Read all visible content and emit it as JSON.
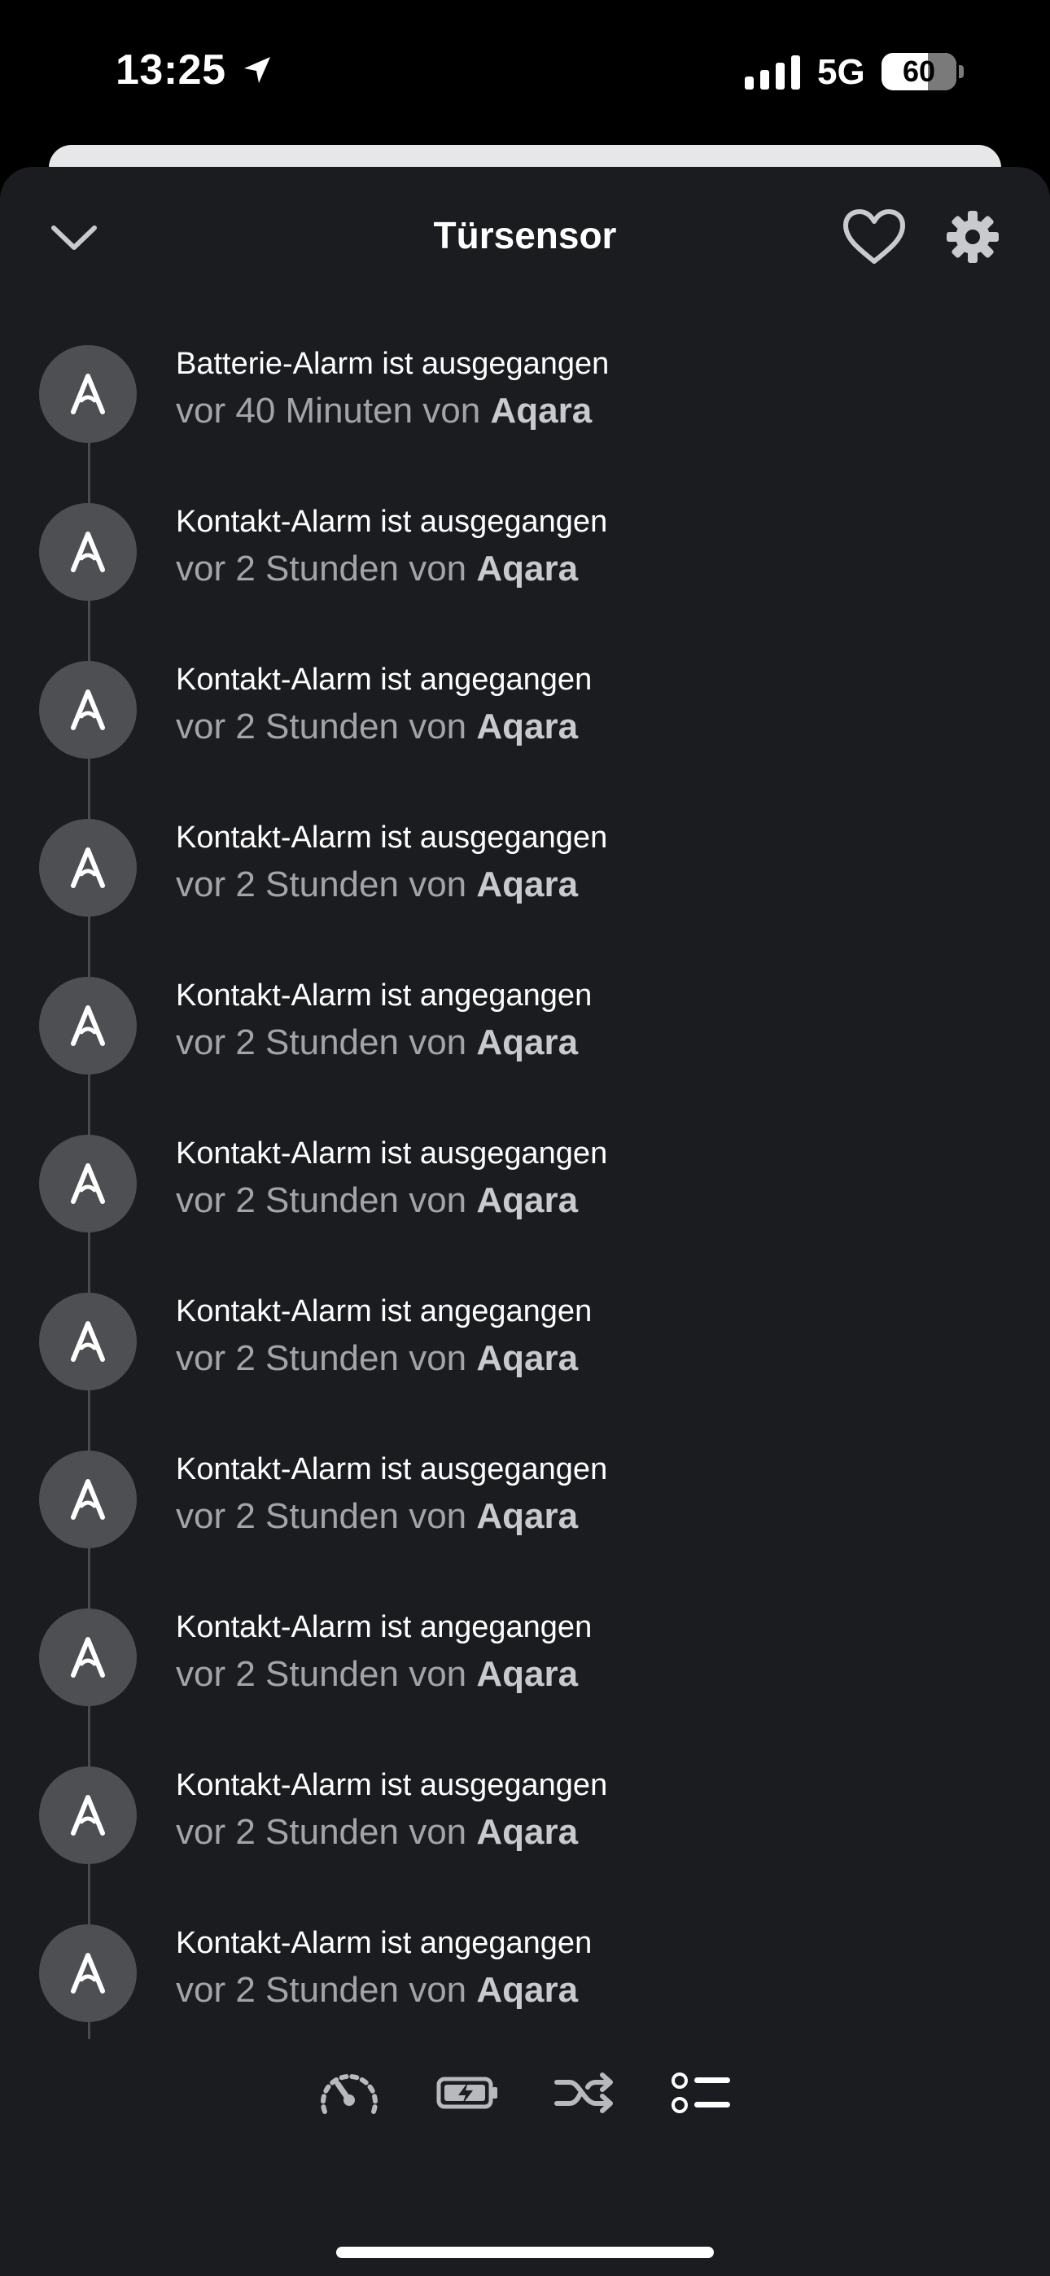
{
  "status_bar": {
    "time": "13:25",
    "network": "5G",
    "battery": "60"
  },
  "header": {
    "title": "Türsensor"
  },
  "events": [
    {
      "title": "Batterie-Alarm ist ausgegangen",
      "time": "vor 40 Minuten",
      "by": "von",
      "source": "Aqara"
    },
    {
      "title": "Kontakt-Alarm ist ausgegangen",
      "time": "vor 2 Stunden",
      "by": "von",
      "source": "Aqara"
    },
    {
      "title": "Kontakt-Alarm ist angegangen",
      "time": "vor 2 Stunden",
      "by": "von",
      "source": "Aqara"
    },
    {
      "title": "Kontakt-Alarm ist ausgegangen",
      "time": "vor 2 Stunden",
      "by": "von",
      "source": "Aqara"
    },
    {
      "title": "Kontakt-Alarm ist angegangen",
      "time": "vor 2 Stunden",
      "by": "von",
      "source": "Aqara"
    },
    {
      "title": "Kontakt-Alarm ist ausgegangen",
      "time": "vor 2 Stunden",
      "by": "von",
      "source": "Aqara"
    },
    {
      "title": "Kontakt-Alarm ist angegangen",
      "time": "vor 2 Stunden",
      "by": "von",
      "source": "Aqara"
    },
    {
      "title": "Kontakt-Alarm ist ausgegangen",
      "time": "vor 2 Stunden",
      "by": "von",
      "source": "Aqara"
    },
    {
      "title": "Kontakt-Alarm ist angegangen",
      "time": "vor 2 Stunden",
      "by": "von",
      "source": "Aqara"
    },
    {
      "title": "Kontakt-Alarm ist ausgegangen",
      "time": "vor 2 Stunden",
      "by": "von",
      "source": "Aqara"
    },
    {
      "title": "Kontakt-Alarm ist angegangen",
      "time": "vor 2 Stunden",
      "by": "von",
      "source": "Aqara"
    }
  ],
  "icons": {
    "header": [
      "chevron-down-icon",
      "heart-icon",
      "gear-icon"
    ],
    "event_avatar": "aqara-logo-icon",
    "tabs": [
      "gauge-icon",
      "battery-charging-icon",
      "shuffle-icon",
      "list-icon"
    ]
  },
  "colors": {
    "sheet_background": "#1b1c20",
    "avatar_background": "#4e4f53",
    "secondary_text": "#a3a4a8",
    "icon_gray": "#b8b9bd"
  }
}
